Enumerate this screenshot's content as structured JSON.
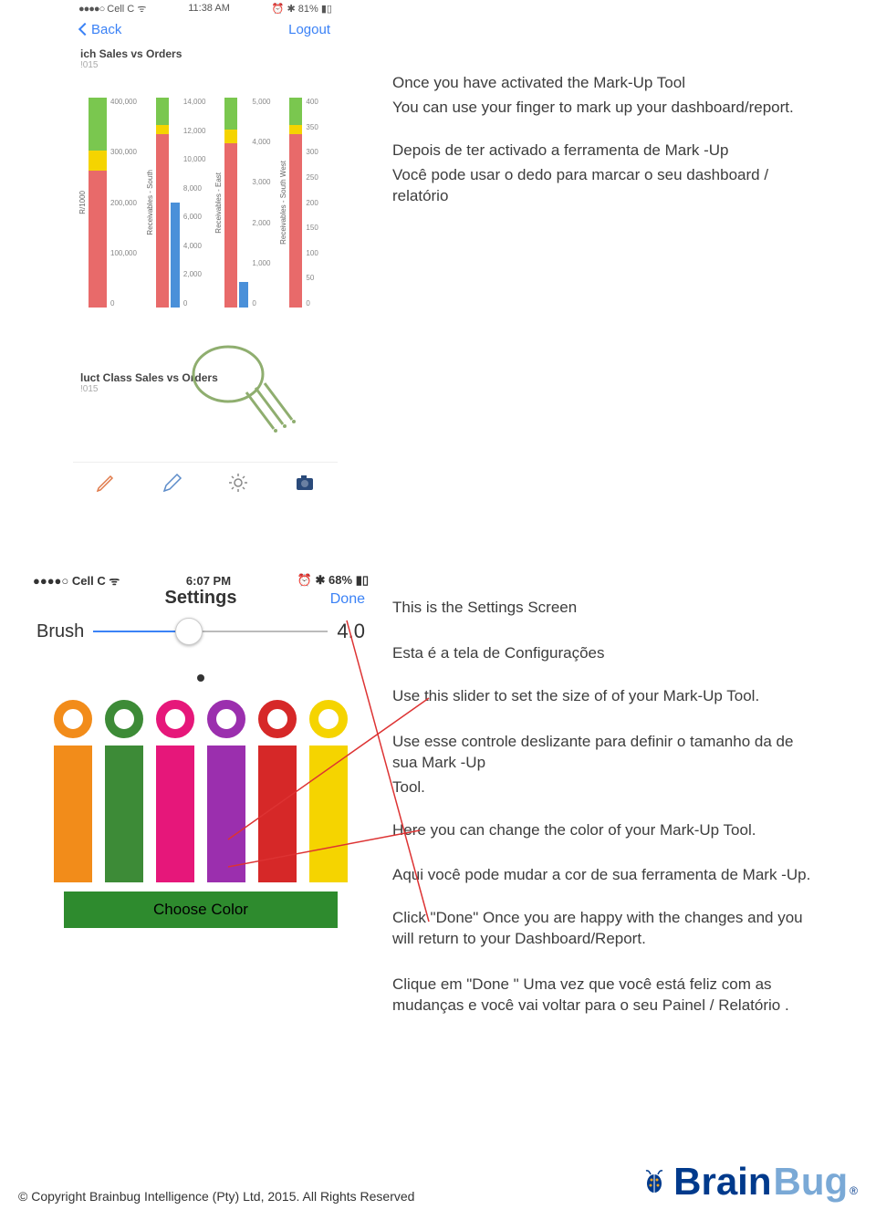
{
  "phone1": {
    "status": {
      "carrier": "Cell C",
      "time": "11:38 AM",
      "battery": "81%"
    },
    "nav": {
      "back": "Back",
      "logout": "Logout"
    },
    "section1_title": "ich Sales vs Orders",
    "section1_sub": "!015",
    "section2_title": "luct Class Sales vs Orders",
    "section2_sub": "!015",
    "chart1_axis": [
      "400,000",
      "300,000",
      "200,000",
      "100,000",
      "0"
    ],
    "chart1_vlabel": "R/1000",
    "chart2_axis": [
      "14,000",
      "12,000",
      "10,000",
      "8,000",
      "6,000",
      "4,000",
      "2,000",
      "0"
    ],
    "chart2_vlabel": "Receivables - South",
    "chart3_axis": [
      "5,000",
      "4,000",
      "3,000",
      "2,000",
      "1,000",
      "0"
    ],
    "chart3_vlabel": "Receivables - East",
    "chart4_axis": [
      "400",
      "350",
      "300",
      "250",
      "200",
      "150",
      "100",
      "50",
      "0"
    ],
    "chart4_vlabel": "Receivables - South West"
  },
  "right1": {
    "p1": "Once you have activated the Mark-Up Tool",
    "p2": "You can use your finger to mark up your dashboard/report.",
    "p3": "Depois de ter activado a ferramenta de Mark -Up",
    "p4": "Você pode usar o dedo para marcar o seu dashboard / relatório"
  },
  "phone2": {
    "status": {
      "carrier": "Cell C",
      "time": "6:07 PM",
      "battery": "68%"
    },
    "title": "Settings",
    "done": "Done",
    "brush_label": "Brush",
    "brush_value": "4.0",
    "choose": "Choose Color",
    "colors": [
      "#f28c1a",
      "#3d8b37",
      "#e6177a",
      "#9b2fae",
      "#d62828",
      "#f5d400"
    ]
  },
  "right2": {
    "b1a": "This is the Settings Screen",
    "b1b": "Esta é a tela de Configurações",
    "b2a": "Use this slider to set the size of of your Mark-Up Tool.",
    "b2b": "Use esse controle deslizante para definir o tamanho da de sua Mark -Up",
    "b2c": "Tool.",
    "b3a": "Here you can change the color of your Mark-Up Tool.",
    "b3b": "Aqui você pode mudar a cor de sua ferramenta de Mark -Up.",
    "b4a": "Click \"Done\" Once you are happy with the changes and you will return to your Dashboard/Report.",
    "b4b": "Clique em \"Done \" Uma vez que você está feliz com as mudanças e você vai voltar para o seu Painel / Relatório ."
  },
  "footer": {
    "copy": "© Copyright Brainbug Intelligence (Pty) Ltd, 2015. All Rights Reserved",
    "brain": "Brain",
    "bug": "Bug"
  },
  "chart_data": [
    {
      "type": "bar",
      "title": "ich Sales vs Orders",
      "ylim": [
        0,
        400000
      ],
      "vlabel": "R/1000",
      "series": [
        {
          "name": "bar1",
          "segments": [
            {
              "color": "#e86a6a",
              "to": 300000
            },
            {
              "color": "#f5d400",
              "to": 340000
            },
            {
              "color": "#7ac74f",
              "to": 400000
            }
          ]
        }
      ]
    },
    {
      "type": "bar",
      "ylim": [
        0,
        14000
      ],
      "vlabel": "Receivables - South",
      "series": [
        {
          "name": "bar1",
          "segments": [
            {
              "color": "#e86a6a",
              "to": 12000
            },
            {
              "color": "#f5d400",
              "to": 12500
            },
            {
              "color": "#7ac74f",
              "to": 14000
            }
          ]
        },
        {
          "name": "bar2",
          "segments": [
            {
              "color": "#4a90d9",
              "to": 7000
            }
          ]
        }
      ]
    },
    {
      "type": "bar",
      "ylim": [
        0,
        5000
      ],
      "vlabel": "Receivables - East",
      "series": [
        {
          "name": "bar1",
          "segments": [
            {
              "color": "#e86a6a",
              "to": 4000
            },
            {
              "color": "#f5d400",
              "to": 4300
            },
            {
              "color": "#7ac74f",
              "to": 5000
            }
          ]
        },
        {
          "name": "bar2",
          "segments": [
            {
              "color": "#4a90d9",
              "to": 600
            }
          ]
        }
      ]
    },
    {
      "type": "bar",
      "ylim": [
        0,
        400
      ],
      "vlabel": "Receivables - South West",
      "series": [
        {
          "name": "bar1",
          "segments": [
            {
              "color": "#e86a6a",
              "to": 350
            },
            {
              "color": "#f5d400",
              "to": 365
            },
            {
              "color": "#7ac74f",
              "to": 400
            }
          ]
        }
      ]
    }
  ]
}
